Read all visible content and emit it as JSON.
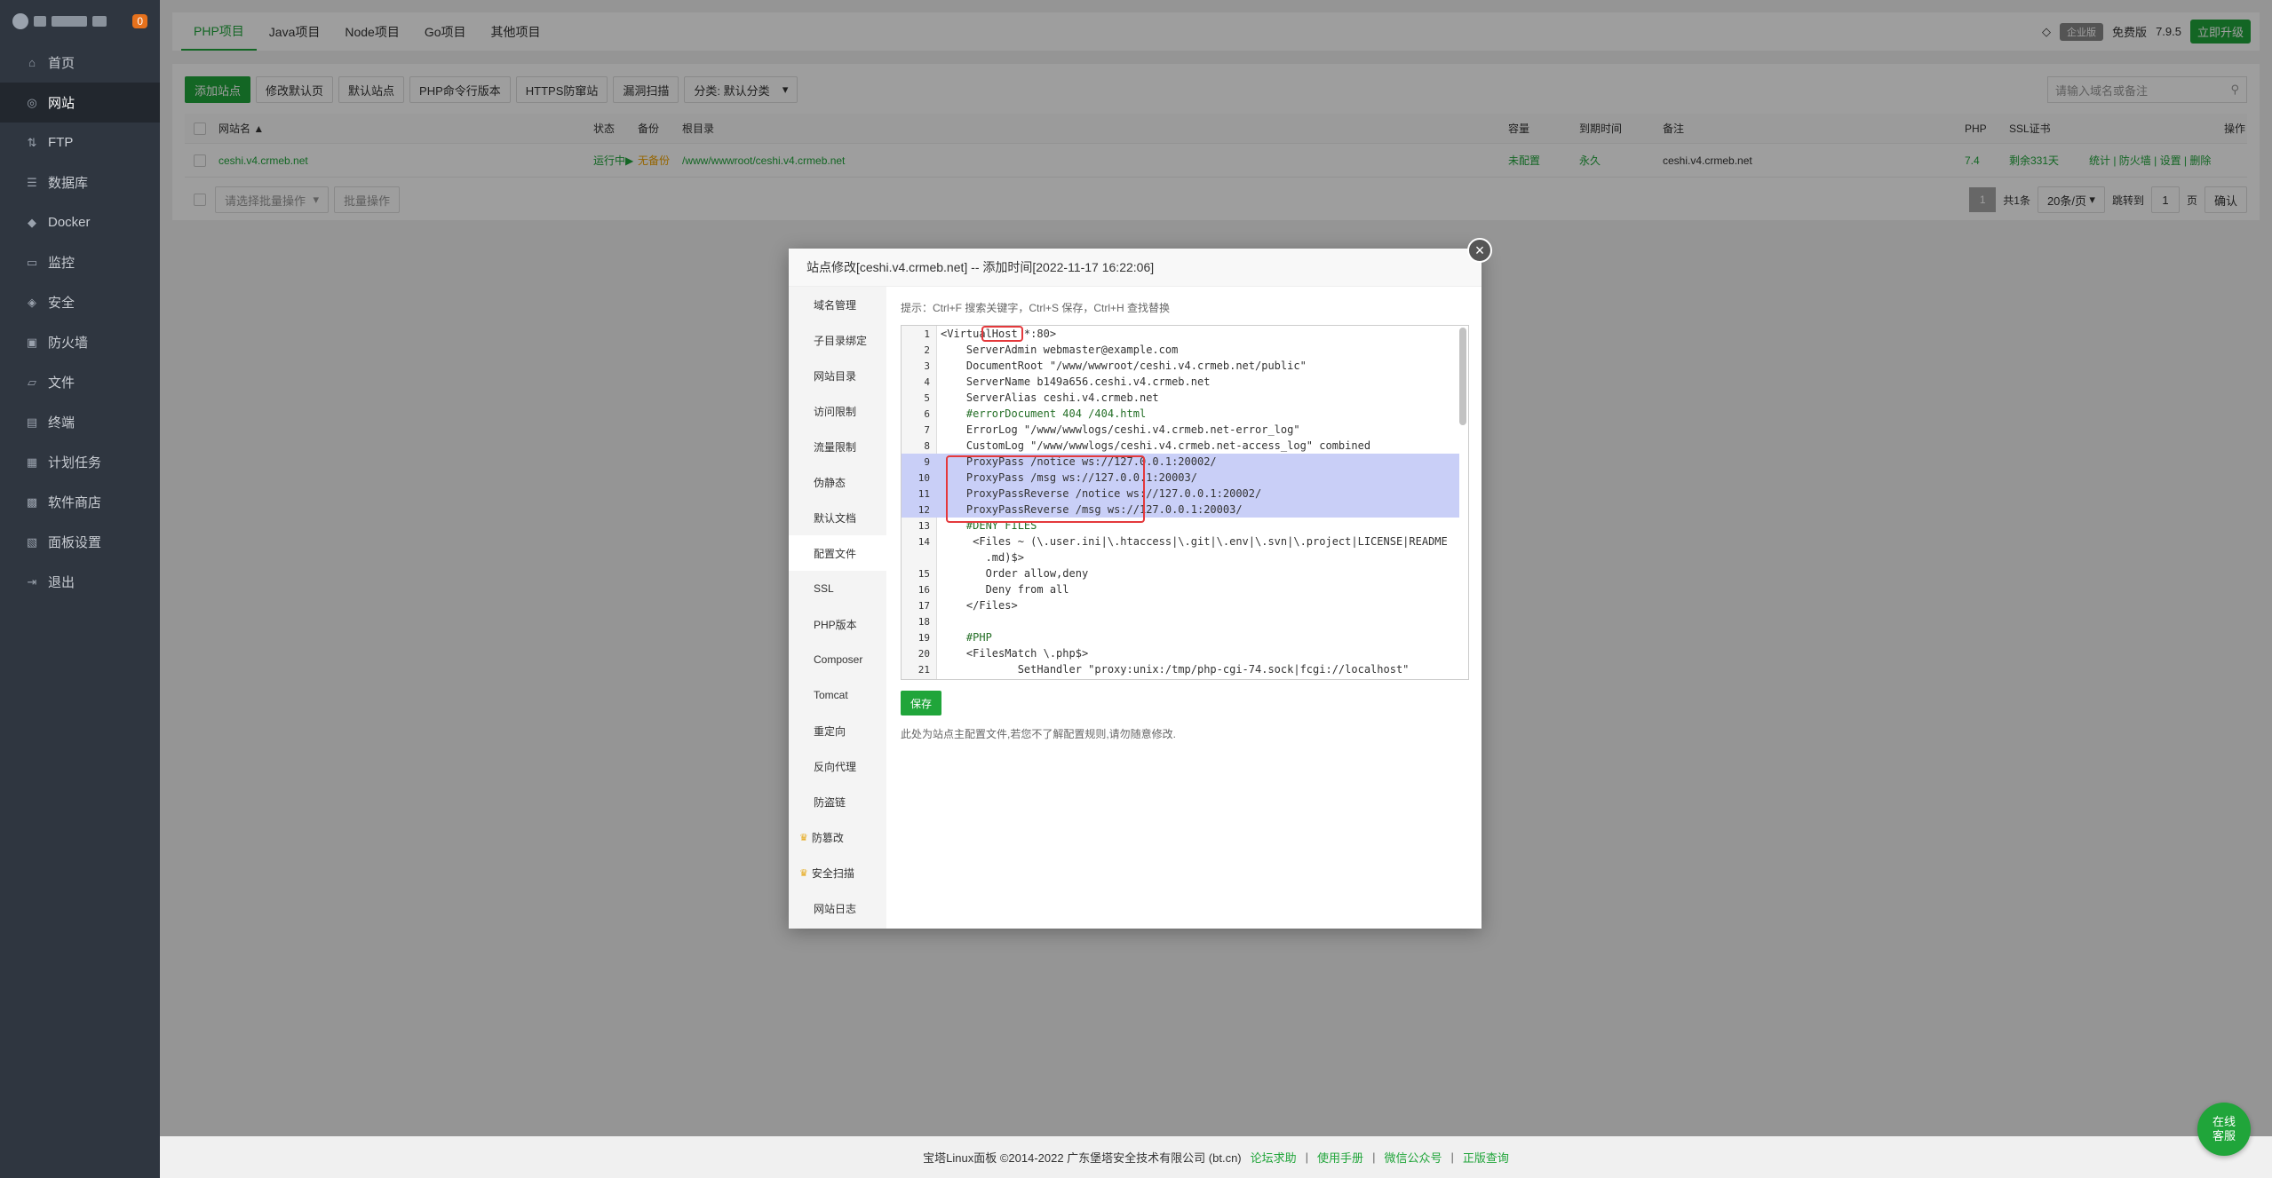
{
  "sidebar": {
    "badge": "0",
    "items": [
      {
        "label": "首页",
        "icon": "home-icon",
        "glyph": "⌂"
      },
      {
        "label": "网站",
        "icon": "globe-icon",
        "glyph": "◎"
      },
      {
        "label": "FTP",
        "icon": "ftp-icon",
        "glyph": "⇅"
      },
      {
        "label": "数据库",
        "icon": "database-icon",
        "glyph": "☰"
      },
      {
        "label": "Docker",
        "icon": "docker-icon",
        "glyph": "◆"
      },
      {
        "label": "监控",
        "icon": "monitor-icon",
        "glyph": "▭"
      },
      {
        "label": "安全",
        "icon": "shield-icon",
        "glyph": "◈"
      },
      {
        "label": "防火墙",
        "icon": "firewall-icon",
        "glyph": "▣"
      },
      {
        "label": "文件",
        "icon": "folder-icon",
        "glyph": "▱"
      },
      {
        "label": "终端",
        "icon": "terminal-icon",
        "glyph": "▤"
      },
      {
        "label": "计划任务",
        "icon": "calendar-icon",
        "glyph": "▦"
      },
      {
        "label": "软件商店",
        "icon": "store-icon",
        "glyph": "▩"
      },
      {
        "label": "面板设置",
        "icon": "settings-icon",
        "glyph": "▧"
      },
      {
        "label": "退出",
        "icon": "logout-icon",
        "glyph": "⇥"
      }
    ]
  },
  "topbar": {
    "tabs": [
      "PHP项目",
      "Java项目",
      "Node项目",
      "Go项目",
      "其他项目"
    ],
    "edition_badge": "企业版",
    "free_label": "免费版",
    "version": "7.9.5",
    "upgrade": "立即升级"
  },
  "toolbar": {
    "add_site": "添加站点",
    "edit_default": "修改默认页",
    "default_site": "默认站点",
    "php_cli": "PHP命令行版本",
    "https_guard": "HTTPS防窜站",
    "vuln_scan": "漏洞扫描",
    "category": "分类: 默认分类",
    "search_placeholder": "请输入域名或备注"
  },
  "table": {
    "headers": {
      "name": "网站名 ▲",
      "status": "状态",
      "backup": "备份",
      "root": "根目录",
      "capacity": "容量",
      "expire": "到期时间",
      "note": "备注",
      "php": "PHP",
      "ssl": "SSL证书",
      "ops": "操作"
    },
    "row": {
      "name": "ceshi.v4.crmeb.net",
      "status": "运行中▶",
      "backup": "无备份",
      "root": "/www/wwwroot/ceshi.v4.crmeb.net",
      "capacity": "未配置",
      "expire": "永久",
      "note": "ceshi.v4.crmeb.net",
      "php": "7.4",
      "ssl": "剩余331天",
      "ops": "统计 | 防火墙 | 设置 | 删除"
    },
    "batch_select": "请选择批量操作",
    "batch_btn": "批量操作",
    "page": "1",
    "total": "共1条",
    "per_page": "20条/页",
    "jump_label": "跳转到",
    "jump_value": "1",
    "page_unit": "页",
    "confirm": "确认"
  },
  "modal": {
    "title": "站点修改[ceshi.v4.crmeb.net] -- 添加时间[2022-11-17 16:22:06]",
    "nav": [
      "域名管理",
      "子目录绑定",
      "网站目录",
      "访问限制",
      "流量限制",
      "伪静态",
      "默认文档",
      "配置文件",
      "SSL",
      "PHP版本",
      "Composer",
      "Tomcat",
      "重定向",
      "反向代理",
      "防盗链",
      "防篡改",
      "安全扫描",
      "网站日志"
    ],
    "tip": "提示：Ctrl+F 搜索关键字，Ctrl+S 保存，Ctrl+H 查找替换",
    "save": "保存",
    "note": "此处为站点主配置文件,若您不了解配置规则,请勿随意修改.",
    "code": [
      {
        "n": "1",
        "t": "<VirtualHost *:80>"
      },
      {
        "n": "2",
        "t": "    ServerAdmin webmaster@example.com"
      },
      {
        "n": "3",
        "t": "    DocumentRoot \"/www/wwwroot/ceshi.v4.crmeb.net/public\""
      },
      {
        "n": "4",
        "t": "    ServerName b149a656.ceshi.v4.crmeb.net"
      },
      {
        "n": "5",
        "t": "    ServerAlias ceshi.v4.crmeb.net"
      },
      {
        "n": "6",
        "t": "    #errorDocument 404 /404.html"
      },
      {
        "n": "7",
        "t": "    ErrorLog \"/www/wwwlogs/ceshi.v4.crmeb.net-error_log\""
      },
      {
        "n": "8",
        "t": "    CustomLog \"/www/wwwlogs/ceshi.v4.crmeb.net-access_log\" combined"
      },
      {
        "n": "9",
        "t": "    ProxyPass /notice ws://127.0.0.1:20002/"
      },
      {
        "n": "10",
        "t": "    ProxyPass /msg ws://127.0.0.1:20003/"
      },
      {
        "n": "11",
        "t": "    ProxyPassReverse /notice ws://127.0.0.1:20002/"
      },
      {
        "n": "12",
        "t": "    ProxyPassReverse /msg ws://127.0.0.1:20003/"
      },
      {
        "n": "13",
        "t": "    #DENY FILES"
      },
      {
        "n": "14",
        "t": "     <Files ~ (\\.user.ini|\\.htaccess|\\.git|\\.env|\\.svn|\\.project|LICENSE|README"
      },
      {
        "n": "",
        "t": "       .md)$>"
      },
      {
        "n": "15",
        "t": "       Order allow,deny"
      },
      {
        "n": "16",
        "t": "       Deny from all"
      },
      {
        "n": "17",
        "t": "    </Files>"
      },
      {
        "n": "18",
        "t": ""
      },
      {
        "n": "19",
        "t": "    #PHP"
      },
      {
        "n": "20",
        "t": "    <FilesMatch \\.php$>"
      },
      {
        "n": "21",
        "t": "            SetHandler \"proxy:unix:/tmp/php-cgi-74.sock|fcgi://localhost\""
      }
    ]
  },
  "footer": {
    "copyright": "宝塔Linux面板 ©2014-2022 广东堡塔安全技术有限公司 (bt.cn)",
    "links": [
      "论坛求助",
      "使用手册",
      "微信公众号",
      "正版查询"
    ]
  },
  "chat": {
    "line1": "在线",
    "line2": "客服"
  }
}
